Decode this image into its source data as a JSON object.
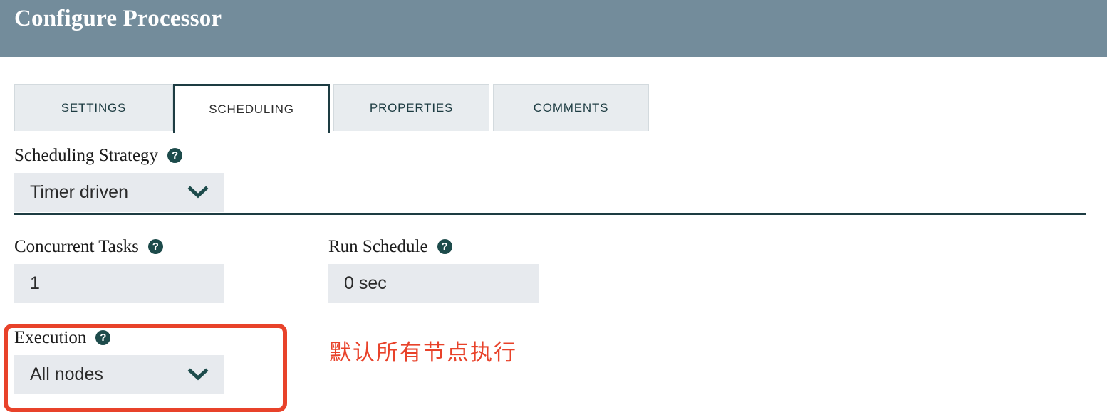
{
  "header": {
    "title": "Configure Processor",
    "background_color": "#738c9b"
  },
  "tabs": {
    "active_index": 1,
    "items": [
      {
        "label": "SETTINGS"
      },
      {
        "label": "SCHEDULING"
      },
      {
        "label": "PROPERTIES"
      },
      {
        "label": "COMMENTS"
      }
    ]
  },
  "form": {
    "help_glyph": "?",
    "fields": [
      {
        "label": "Scheduling Strategy",
        "value": "Timer driven",
        "type": "select"
      },
      {
        "label": "Concurrent Tasks",
        "value": "1",
        "type": "text"
      },
      {
        "label": "Run Schedule",
        "value": "0 sec",
        "type": "text"
      },
      {
        "label": "Execution",
        "value": "All nodes",
        "type": "select"
      }
    ]
  },
  "annotations": {
    "highlight_color": "#e8422a",
    "note_text": "默认所有节点执行"
  },
  "colors": {
    "accent_teal": "#1d4b4b",
    "tab_border": "#1d3c42",
    "control_background": "#e7eaee",
    "tab_inactive_background": "#e8ecef"
  }
}
